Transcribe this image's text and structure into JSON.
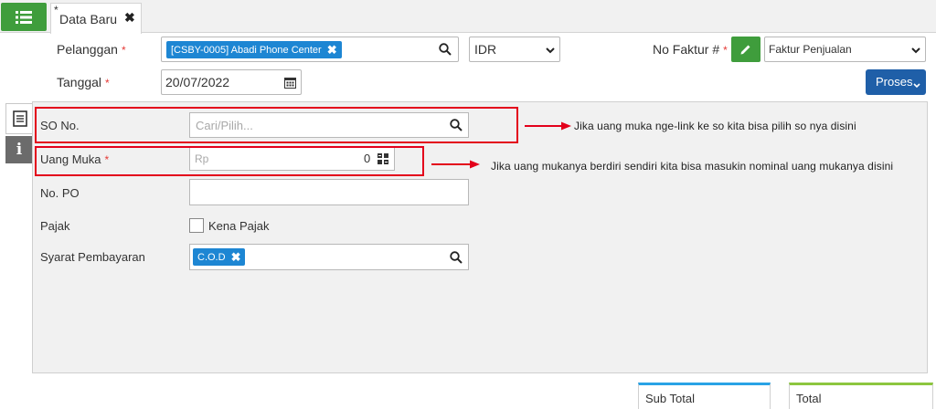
{
  "tab": {
    "modified_mark": "*",
    "title": "Data Baru",
    "close": "✖"
  },
  "header": {
    "pelanggan_label": "Pelanggan",
    "pelanggan_value": "[CSBY-0005] Abadi Phone Center",
    "currency": "IDR",
    "no_faktur_label": "No Faktur #",
    "faktur_type": "Faktur Penjualan",
    "tanggal_label": "Tanggal",
    "tanggal_value": "20/07/2022",
    "proses_label": "Proses",
    "required_mark": "*"
  },
  "form": {
    "so_label": "SO No.",
    "so_placeholder": "Cari/Pilih...",
    "uang_muka_label": "Uang Muka",
    "uang_muka_prefix": "Rp",
    "uang_muka_value": "0",
    "po_label": "No. PO",
    "pajak_label": "Pajak",
    "kena_pajak_label": "Kena Pajak",
    "syarat_label": "Syarat Pembayaran",
    "syarat_value": "C.O.D"
  },
  "annotations": {
    "note_so": "Jika uang muka nge-link ke so kita bisa pilih so nya disini",
    "note_uang_muka": "Jika uang mukanya berdiri sendiri kita bisa masukin nominal uang mukanya disini"
  },
  "totals": {
    "sub_total": "Sub Total",
    "total": "Total"
  },
  "colors": {
    "green": "#3f9d3c",
    "blue": "#1d86d3",
    "proses": "#1f5fa8",
    "annotation_red": "#e3001b"
  }
}
